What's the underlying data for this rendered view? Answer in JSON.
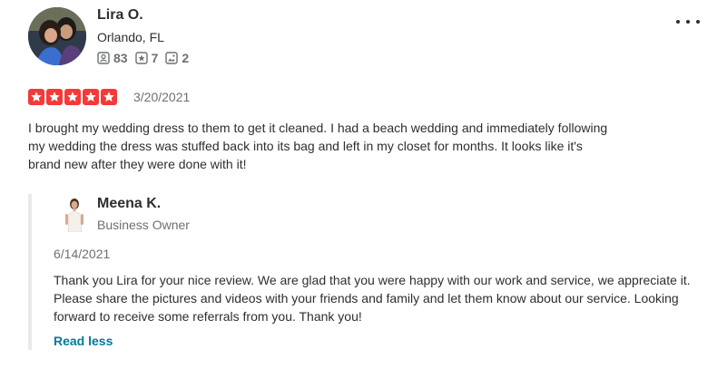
{
  "review": {
    "user": {
      "name": "Lira O.",
      "location": "Orlando, FL",
      "friends_count": "83",
      "reviews_count": "7",
      "photos_count": "2"
    },
    "more_icon": "more-horizontal-icon",
    "rating": 5,
    "rating_color": "#f43939",
    "date": "3/20/2021",
    "text": "I brought my wedding dress to them to get it cleaned. I had a beach wedding and immediately following my wedding the dress was stuffed back into its bag and left in my closet for months. It looks like it's brand new after they were done with it!"
  },
  "reply": {
    "owner_name": "Meena K.",
    "owner_role": "Business Owner",
    "date": "6/14/2021",
    "text": "Thank you Lira for your nice review. We are glad that you were happy with our work and service, we appreciate it. Please share the pictures and videos with your friends and family and let them know about our service. Looking forward to receive some referrals from you. Thank you!",
    "read_less_label": "Read less"
  },
  "colors": {
    "text": "#2d2e2f",
    "muted": "#6e7072",
    "link": "#027a97",
    "reply_border": "#e9e9ea"
  }
}
